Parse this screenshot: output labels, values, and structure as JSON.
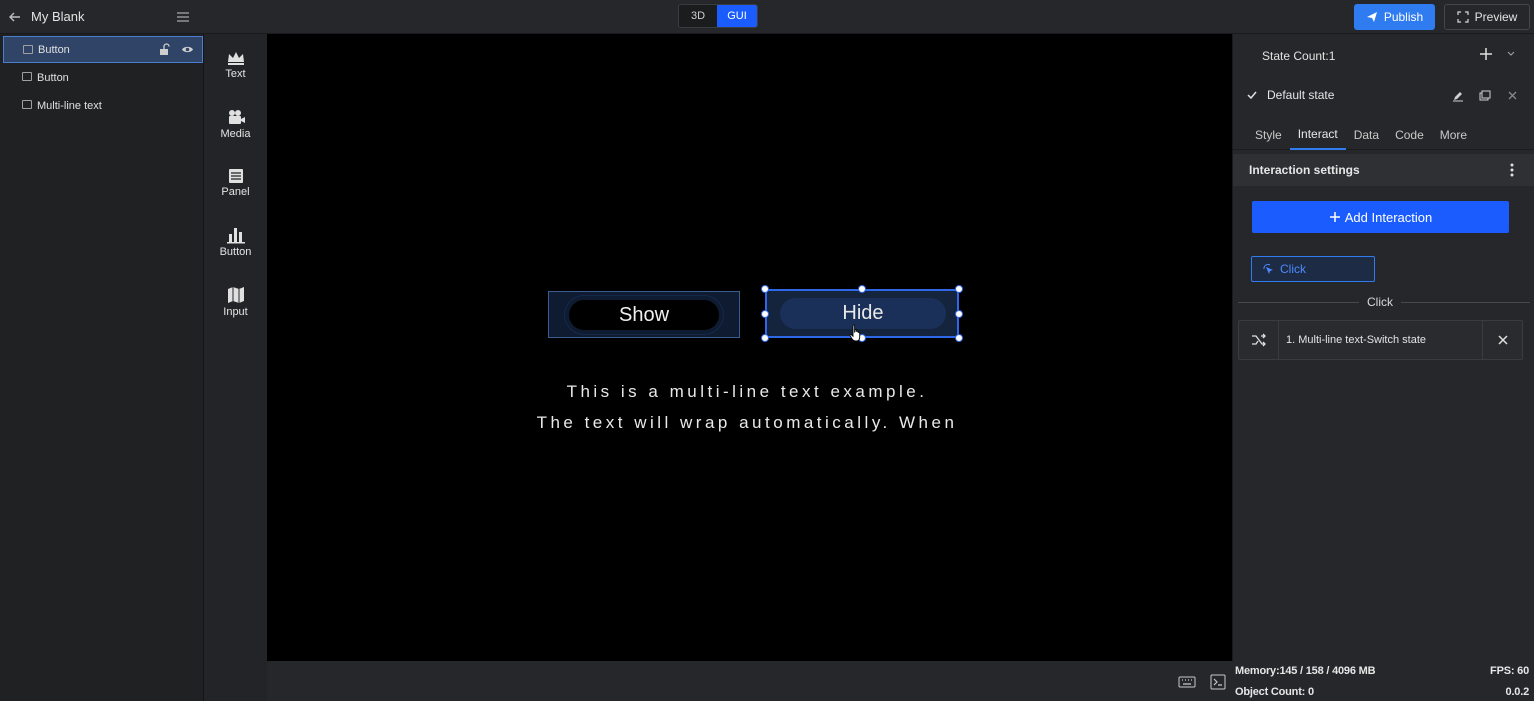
{
  "app": {
    "title": "My Blank"
  },
  "mode": {
    "option_3d": "3D",
    "option_gui": "GUI",
    "active": "GUI"
  },
  "header": {
    "publish_label": "Publish",
    "preview_label": "Preview"
  },
  "layers": [
    {
      "label": "Button",
      "selected": true
    },
    {
      "label": "Button",
      "selected": false
    },
    {
      "label": "Multi-line text",
      "selected": false
    }
  ],
  "components": [
    {
      "label": "Text",
      "icon": "crown-icon"
    },
    {
      "label": "Media",
      "icon": "media-icon"
    },
    {
      "label": "Panel",
      "icon": "panel-icon"
    },
    {
      "label": "Button",
      "icon": "chart-bars-icon"
    },
    {
      "label": "Input",
      "icon": "map-icon"
    }
  ],
  "canvas": {
    "show_button_label": "Show",
    "hide_button_label": "Hide",
    "multiline_text": [
      "This is a multi-line text example.",
      "The text will wrap automatically. When"
    ]
  },
  "props": {
    "state_count": "State Count:1",
    "default_state": "Default state",
    "tabs": [
      "Style",
      "Interact",
      "Data",
      "Code",
      "More"
    ],
    "active_tab": "Interact",
    "section_title": "Interaction settings",
    "add_interaction_label": "Add Interaction",
    "event_chip": "Click",
    "divider_label": "Click",
    "action_label": "1. Multi-line text-Switch state"
  },
  "status": {
    "memory": "Memory:145 / 158 / 4096 MB",
    "fps": "FPS: 60",
    "object_count": "Object Count: 0",
    "version": "0.0.2"
  },
  "colors": {
    "accent": "#1b5cff",
    "publish": "#2f7bf0",
    "selection": "#2e67e8"
  }
}
